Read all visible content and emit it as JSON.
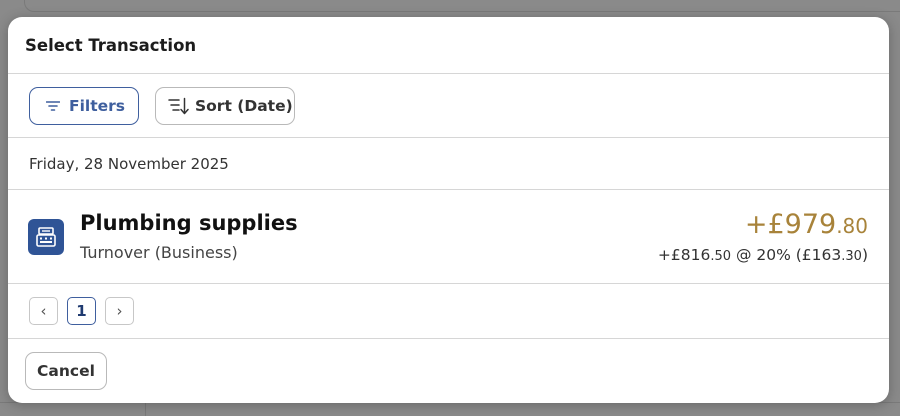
{
  "dialog": {
    "title": "Select Transaction"
  },
  "toolbar": {
    "filters_label": "Filters",
    "sort_label": "Sort (Date)"
  },
  "group": {
    "date_heading": "Friday, 28 November 2025"
  },
  "transaction": {
    "title": "Plumbing supplies",
    "category": "Turnover (Business)",
    "amount_major": "+£979",
    "amount_minor": ".80",
    "net_major": "+£816",
    "net_minor": ".50",
    "vat_text": " @ 20% (£163",
    "vat_minor": ".30",
    "vat_close": ")",
    "icon": "cash-register-icon",
    "amount_color": "#a8833a",
    "icon_bg": "#2f5496"
  },
  "pagination": {
    "prev": "‹",
    "current_page": "1",
    "next": "›"
  },
  "footer": {
    "cancel_label": "Cancel"
  },
  "colors": {
    "accent": "#3f5f9e"
  }
}
